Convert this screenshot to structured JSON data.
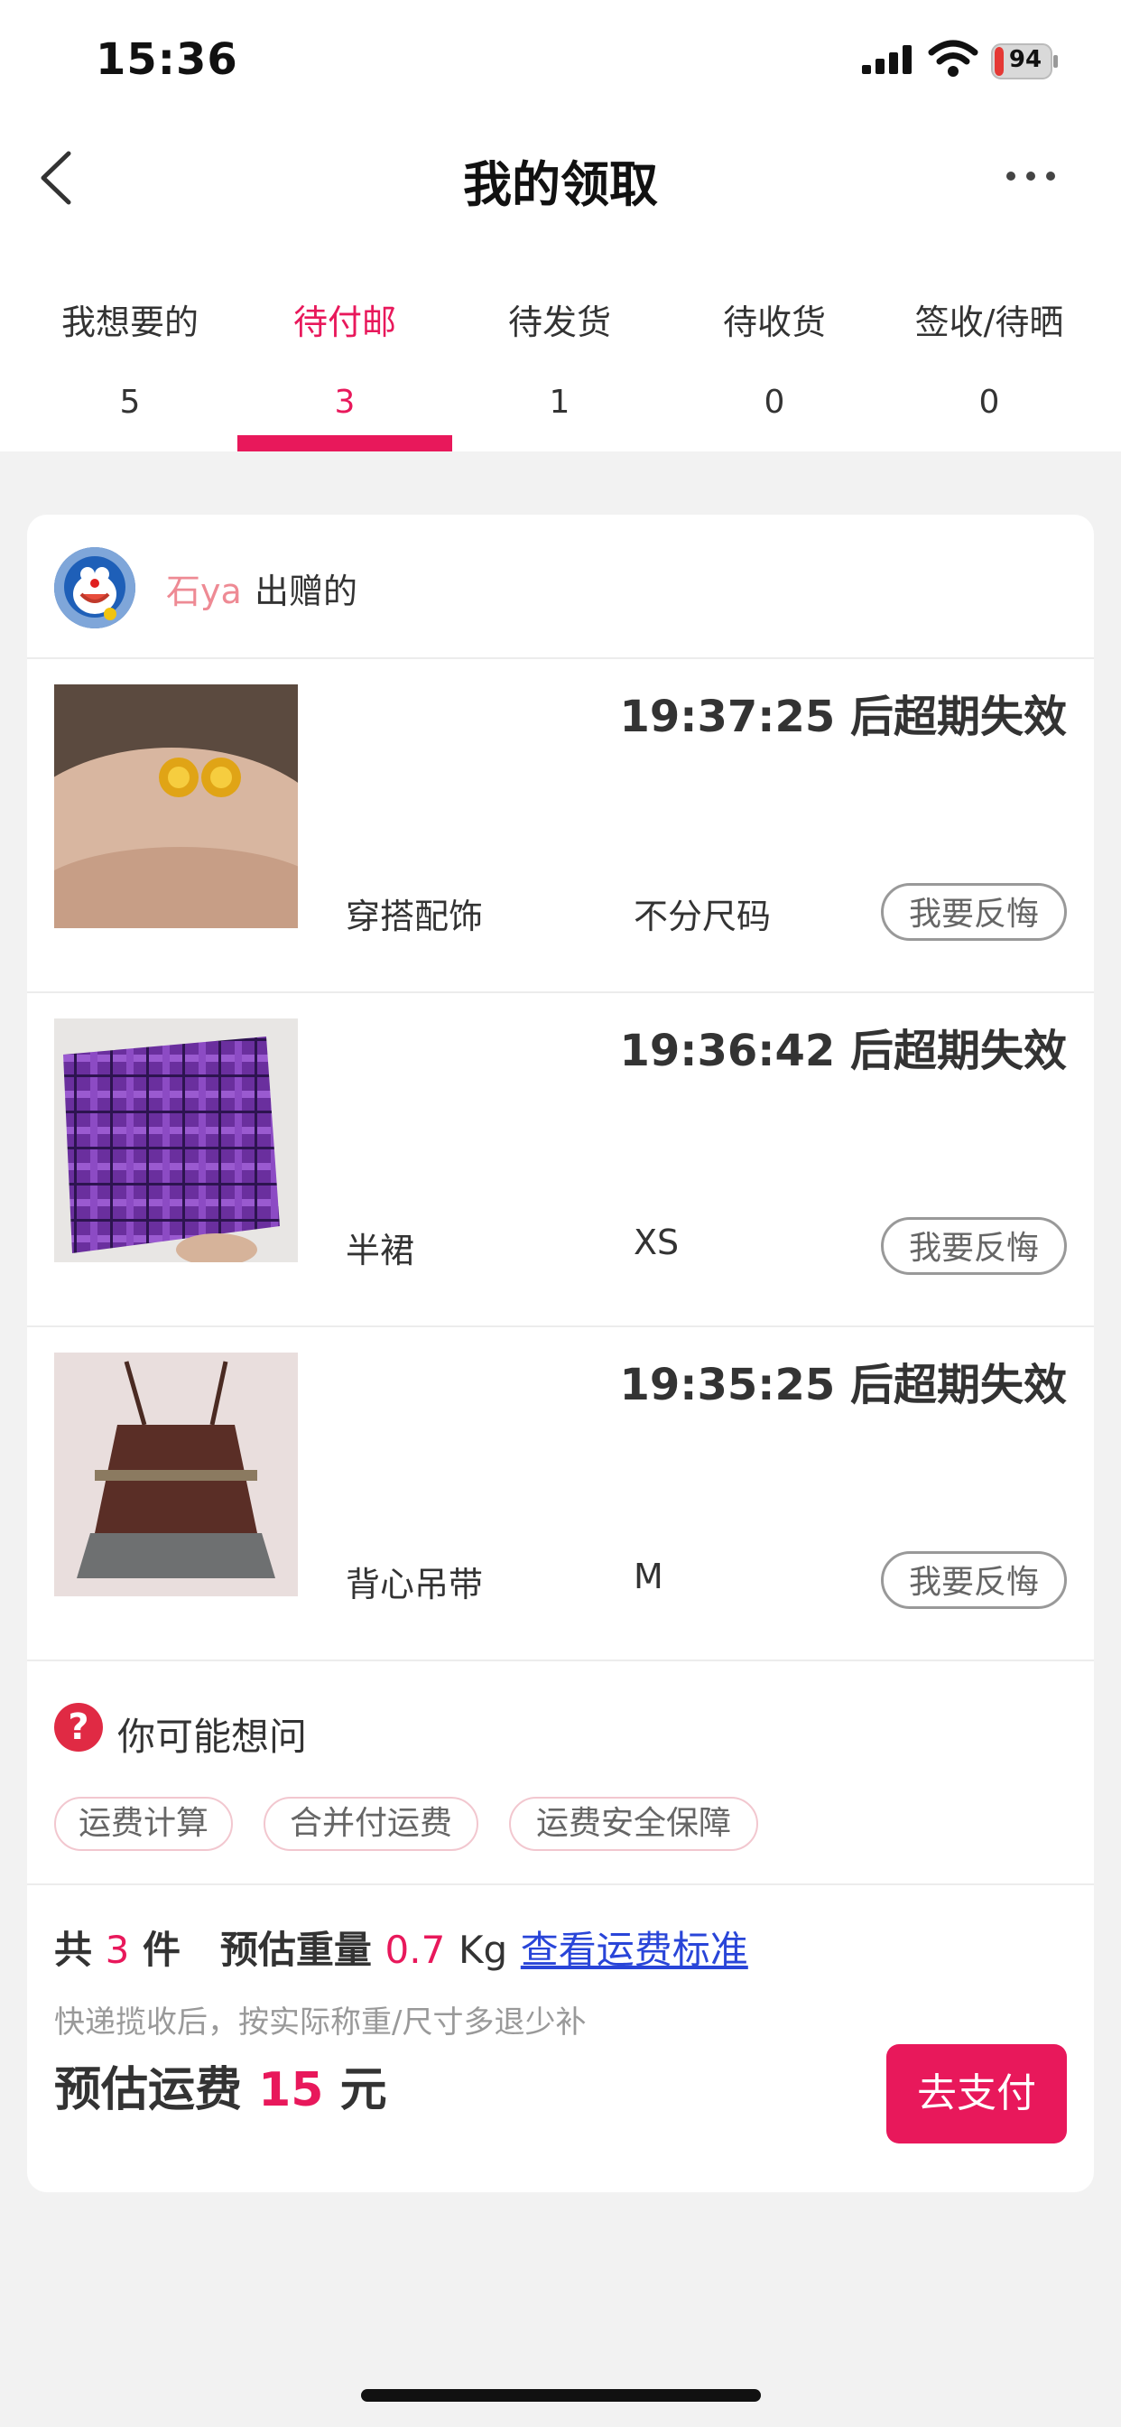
{
  "status_bar": {
    "time": "15:36",
    "battery": "94"
  },
  "nav": {
    "title": "我的领取"
  },
  "tabs": [
    {
      "label": "我想要的",
      "count": "5"
    },
    {
      "label": "待付邮",
      "count": "3"
    },
    {
      "label": "待发货",
      "count": "1"
    },
    {
      "label": "待收货",
      "count": "0"
    },
    {
      "label": "签收/待晒",
      "count": "0"
    }
  ],
  "giver": {
    "name": "石ya",
    "suffix": "出赠的"
  },
  "items": [
    {
      "countdown": "19:37:25 后超期失效",
      "category": "穿搭配饰",
      "size": "不分尺码",
      "action": "我要反悔"
    },
    {
      "countdown": "19:36:42 后超期失效",
      "category": "半裙",
      "size": "XS",
      "action": "我要反悔"
    },
    {
      "countdown": "19:35:25 后超期失效",
      "category": "背心吊带",
      "size": "M",
      "action": "我要反悔"
    }
  ],
  "faq": {
    "title": "你可能想问",
    "chips": [
      "运费计算",
      "合并付运费",
      "运费安全保障"
    ]
  },
  "summary": {
    "total_prefix": "共",
    "total_count": "3",
    "total_suffix": "件",
    "weight_label": "预估重量",
    "weight_value": "0.7",
    "weight_unit": "Kg",
    "link": "查看运费标准",
    "note": "快递揽收后，按实际称重/尺寸多退少补",
    "fee_label": "预估运费",
    "fee_value": "15",
    "fee_unit": "元",
    "pay_button": "去支付"
  },
  "colors": {
    "accent": "#e8185b",
    "link": "#2945d8",
    "giver_name": "#ee8a94"
  }
}
